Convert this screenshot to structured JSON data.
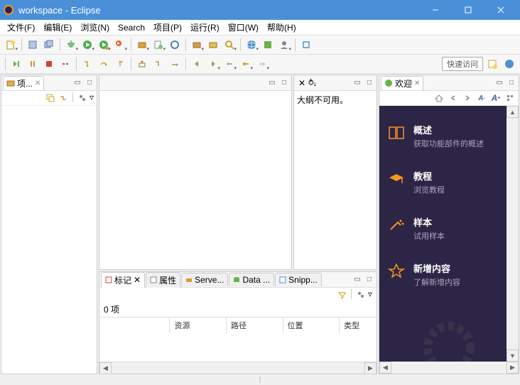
{
  "window": {
    "title": "workspace - Eclipse"
  },
  "menu": {
    "file": "文件(F)",
    "edit": "编辑(E)",
    "navigate": "浏览(N)",
    "search": "Search",
    "project": "项目(P)",
    "run": "运行(R)",
    "window": "窗口(W)",
    "help": "帮助(H)"
  },
  "toolbar": {
    "quick_access": "快速访问"
  },
  "project_explorer": {
    "tab_label": "项..."
  },
  "outline": {
    "message": "大纲不可用。",
    "pin": "⥁₁"
  },
  "bottom": {
    "tabs": {
      "markers": "标记",
      "properties": "属性",
      "servers": "Serve...",
      "data": "Data ...",
      "snippets": "Snipp..."
    },
    "count": "0 项",
    "columns": {
      "c0": "",
      "c1": "资源",
      "c2": "路径",
      "c3": "位置",
      "c4": "类型"
    }
  },
  "welcome": {
    "tab_label": "欢迎",
    "items": [
      {
        "title": "概述",
        "desc": "获取功能部件的概述"
      },
      {
        "title": "教程",
        "desc": "浏览教程"
      },
      {
        "title": "样本",
        "desc": "试用样本"
      },
      {
        "title": "新增内容",
        "desc": "了解新增内容"
      }
    ],
    "font_small": "A'",
    "font_large": "A'"
  }
}
